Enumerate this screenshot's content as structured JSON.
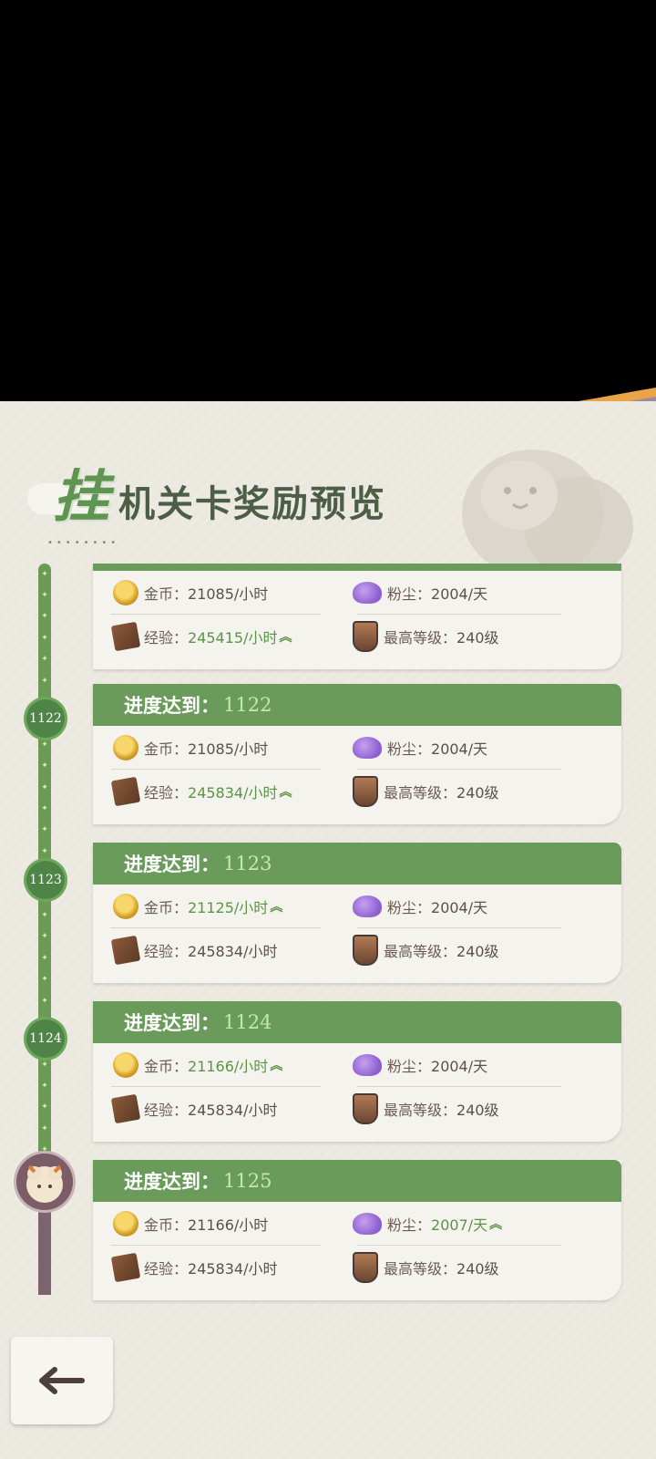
{
  "title": {
    "big_char": "挂",
    "rest": "机关卡奖励预览"
  },
  "colors": {
    "green": "#6a9b5b",
    "card_bg": "#f5f3ee",
    "text": "#6b5a51",
    "highlight": "#5b9447"
  },
  "icons": {
    "gold": "gold-coin-icon",
    "dust": "purple-dust-icon",
    "exp": "exp-book-icon",
    "level": "level-shield-icon",
    "back": "back-arrow-icon"
  },
  "first_card": {
    "gold_label": "金币：",
    "gold_value": "21085/小时",
    "dust_label": "粉尘：",
    "dust_value": "2004/天",
    "exp_label": "经验：",
    "exp_value": "245415/小时",
    "level_label": "最高等级：",
    "level_value": "240级"
  },
  "cards": [
    {
      "node": "1122",
      "head_label": "进度达到：",
      "level": "1122",
      "gold_label": "金币：",
      "gold_value": "21085/小时",
      "dust_label": "粉尘：",
      "dust_value": "2004/天",
      "exp_label": "经验：",
      "exp_value": "245834/小时",
      "level_label": "最高等级：",
      "level_value": "240级"
    },
    {
      "node": "1123",
      "head_label": "进度达到：",
      "level": "1123",
      "gold_label": "金币：",
      "gold_value": "21125/小时",
      "dust_label": "粉尘：",
      "dust_value": "2004/天",
      "exp_label": "经验：",
      "exp_value": "245834/小时",
      "level_label": "最高等级：",
      "level_value": "240级"
    },
    {
      "node": "1124",
      "head_label": "进度达到：",
      "level": "1124",
      "gold_label": "金币：",
      "gold_value": "21166/小时",
      "dust_label": "粉尘：",
      "dust_value": "2004/天",
      "exp_label": "经验：",
      "exp_value": "245834/小时",
      "level_label": "最高等级：",
      "level_value": "240级"
    },
    {
      "head_label": "进度达到：",
      "level": "1125",
      "gold_label": "金币：",
      "gold_value": "21166/小时",
      "dust_label": "粉尘：",
      "dust_value": "2007/天",
      "exp_label": "经验：",
      "exp_value": "245834/小时",
      "level_label": "最高等级：",
      "level_value": "240级"
    }
  ]
}
